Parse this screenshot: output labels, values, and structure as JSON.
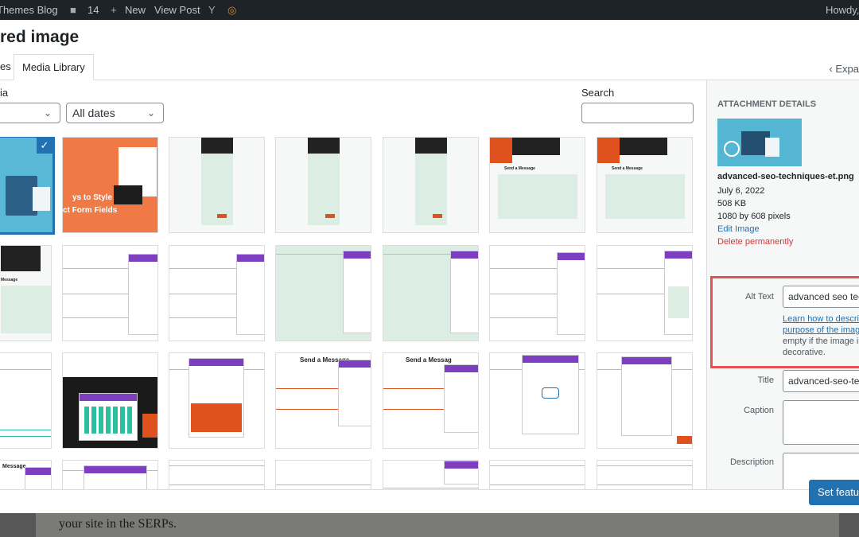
{
  "admin_bar": {
    "site_name": "Themes Blog",
    "comments_count": "14",
    "new_label": "New",
    "view_post_label": "View Post",
    "howdy": "Howdy,"
  },
  "behind_text": "your site in the SERPs.",
  "modal": {
    "title": "red image",
    "tabs": [
      "es",
      "Media Library"
    ],
    "expand_label": "Expa",
    "filter_label": "ia",
    "type_filter": "",
    "date_filter": "All dates",
    "search_label": "Search"
  },
  "sidebar": {
    "heading": "ATTACHMENT DETAILS",
    "filename": "advanced-seo-techniques-et.png",
    "date": "July 6, 2022",
    "size": "508 KB",
    "dimensions": "1080 by 608 pixels",
    "edit_link": "Edit Image",
    "delete_link": "Delete permanently",
    "alt_label": "Alt Text",
    "alt_value": "advanced seo tec",
    "alt_help_link1": "Learn how to describ",
    "alt_help_link2": "purpose of the image",
    "alt_help_text1": "empty if the image is",
    "alt_help_text2": "decorative.",
    "title_label": "Title",
    "title_value": "advanced-seo-tec",
    "caption_label": "Caption",
    "description_label": "Description"
  },
  "thumbnails": {
    "first_caption1": "ys to Style",
    "first_caption2": "ct Form Fields",
    "send_message": "Send a Message",
    "send_message_short": "Send a Messag",
    "message": "Message"
  },
  "footer": {
    "set_button": "Set featur"
  },
  "colors": {
    "accent": "#2271b1",
    "danger": "#d63638",
    "highlight_box": "#e35353",
    "divi_purple": "#7b3fbf"
  }
}
